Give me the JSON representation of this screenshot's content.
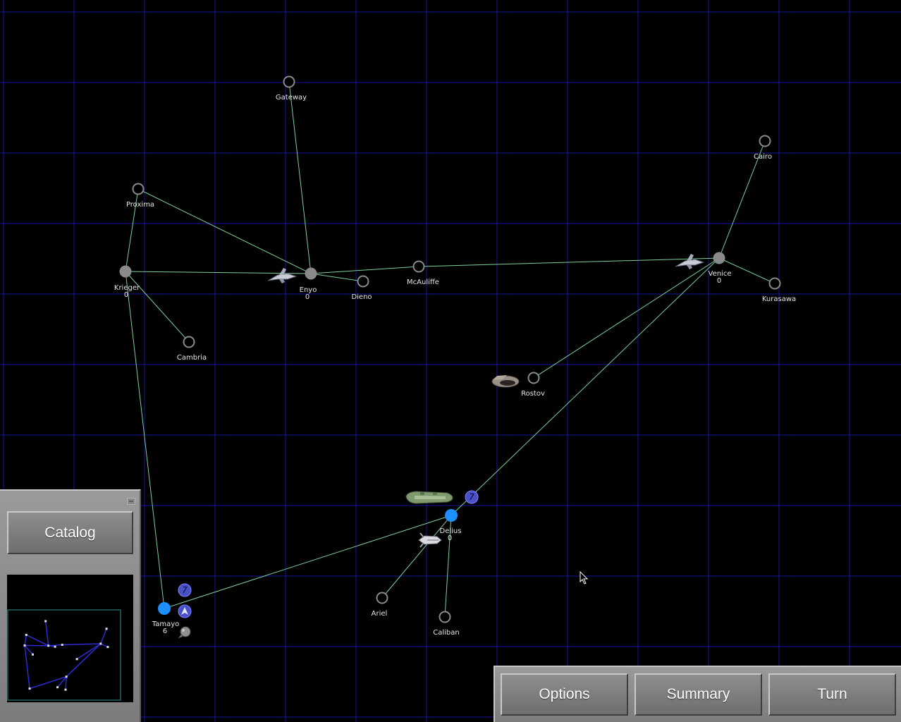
{
  "systems": [
    {
      "name": "Gateway",
      "count": "",
      "type": "empty"
    },
    {
      "name": "Proxima",
      "count": "",
      "type": "empty"
    },
    {
      "name": "Krieger",
      "count": "0",
      "type": "owned"
    },
    {
      "name": "Enyo",
      "count": "0",
      "type": "owned"
    },
    {
      "name": "Dieno",
      "count": "",
      "type": "empty"
    },
    {
      "name": "McAuliffe",
      "count": "",
      "type": "empty"
    },
    {
      "name": "Cairo",
      "count": "",
      "type": "empty"
    },
    {
      "name": "Venice",
      "count": "0",
      "type": "owned"
    },
    {
      "name": "Kurasawa",
      "count": "",
      "type": "empty"
    },
    {
      "name": "Cambria",
      "count": "",
      "type": "empty"
    },
    {
      "name": "Rostov",
      "count": "",
      "type": "empty"
    },
    {
      "name": "Delius",
      "count": "0",
      "type": "player"
    },
    {
      "name": "Ariel",
      "count": "",
      "type": "empty"
    },
    {
      "name": "Caliban",
      "count": "",
      "type": "empty"
    },
    {
      "name": "Tamayo",
      "count": "6",
      "type": "player"
    }
  ],
  "badges": [
    {
      "symbol": "7",
      "at": "Delius"
    },
    {
      "symbol": "7",
      "at": "Tamayo"
    }
  ],
  "colors": {
    "grid": "#1a1acc",
    "lane": "#7ecf9a",
    "empty_system": "#8a8a8a",
    "owned_system": "#8a8a8a",
    "player_system": "#1e8fff",
    "badge": "#4a50c8"
  },
  "catalog": {
    "label": "Catalog"
  },
  "toolbar": {
    "options": "Options",
    "summary": "Summary",
    "turn": "Turn"
  },
  "icons": {
    "minimize": "minimize-icon",
    "cursor": "cursor-icon",
    "ship": "starship-icon",
    "badge": "fleet-count-icon"
  }
}
